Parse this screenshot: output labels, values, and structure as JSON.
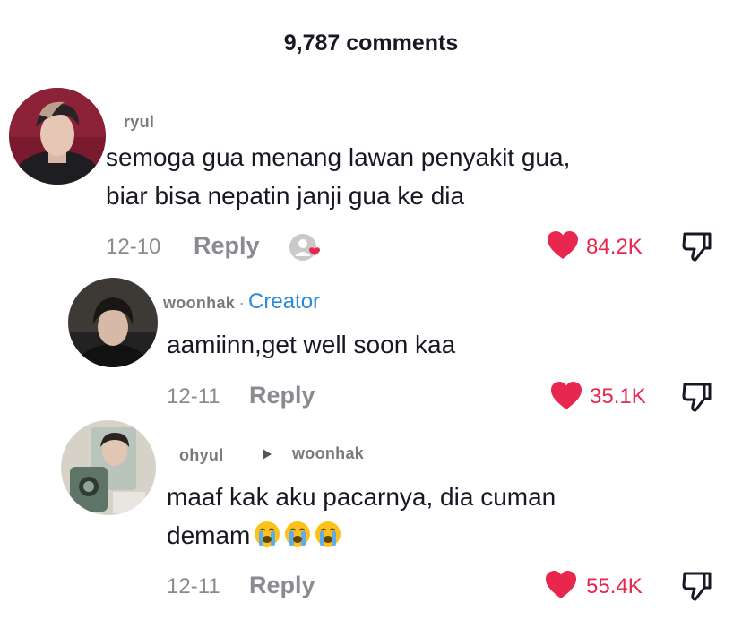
{
  "header": {
    "comment_count": "9,787 comments"
  },
  "comments": [
    {
      "username": "ryul",
      "text_line1": "semoga gua menang lawan penyakit gua,",
      "text_line2": "biar bisa nepatin janji gua ke dia",
      "date": "12-10",
      "reply_label": "Reply",
      "likes": "84.2K",
      "creator_liked_icon": "person-heart-icon"
    },
    {
      "username": "woonhak",
      "separator": "·",
      "creator_badge": "Creator",
      "text": "aamiinn,get well soon kaa",
      "date": "12-11",
      "reply_label": "Reply",
      "likes": "35.1K"
    },
    {
      "username": "ohyul",
      "reply_to": "woonhak",
      "text_line1": "maaf kak aku pacarnya, dia cuman",
      "text_line2": "demam",
      "emoji": [
        "loudly-crying-face",
        "loudly-crying-face",
        "loudly-crying-face"
      ],
      "date": "12-11",
      "reply_label": "Reply",
      "likes": "55.4K"
    }
  ],
  "colors": {
    "like": "#e8264e",
    "creator": "#2b8ad8",
    "muted": "#8a8b91",
    "text": "#161823"
  }
}
